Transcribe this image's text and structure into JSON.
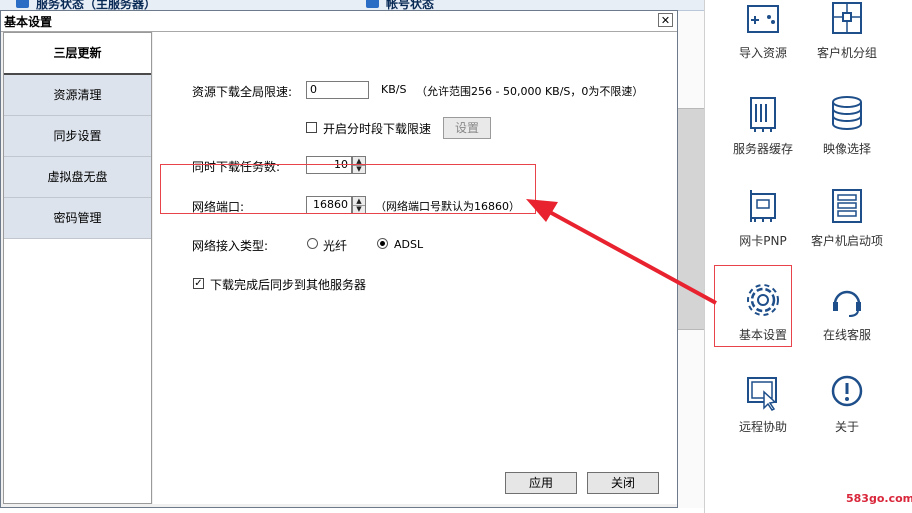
{
  "background_app": {
    "top_tab_1": "服务状态（主服务器）",
    "top_tab_2": "帐号状态"
  },
  "dialog": {
    "title": "基本设置",
    "close_glyph": "✕",
    "sidebar_items": [
      "三层更新",
      "资源清理",
      "同步设置",
      "虚拟盘无盘",
      "密码管理"
    ],
    "active_item": "三层更新",
    "download_limit": {
      "label": "资源下载全局限速:",
      "value": "0",
      "unit": "KB/S",
      "hint": "（允许范围256 - 50,000 KB/S，0为不限速）"
    },
    "timed_limit": {
      "label": "开启分时段下载限速",
      "checked": false,
      "button": "设置"
    },
    "concurrent_tasks": {
      "label": "同时下载任务数:",
      "value": "10"
    },
    "network_port": {
      "label": "网络端口:",
      "value": "16860",
      "hint": "（网络端口号默认为16860）"
    },
    "access_type": {
      "label": "网络接入类型:",
      "options": [
        "光纤",
        "ADSL"
      ],
      "selected": "ADSL"
    },
    "sync_after": {
      "label": "下载完成后同步到其他服务器",
      "checked": true
    },
    "apply_button": "应用",
    "close_button": "关闭"
  },
  "right_panel": {
    "tiles": [
      {
        "label": "导入资源",
        "icon": "gamepad-icon"
      },
      {
        "label": "客户机分组",
        "icon": "group-icon"
      },
      {
        "label": "服务器缓存",
        "icon": "memory-chip-icon"
      },
      {
        "label": "映像选择",
        "icon": "disk-stack-icon"
      },
      {
        "label": "网卡PNP",
        "icon": "network-card-icon"
      },
      {
        "label": "客户机启动项",
        "icon": "list-icon"
      },
      {
        "label": "基本设置",
        "icon": "gear-icon"
      },
      {
        "label": "在线客服",
        "icon": "headset-icon"
      },
      {
        "label": "远程协助",
        "icon": "remote-screen-icon"
      },
      {
        "label": "关于",
        "icon": "info-icon"
      }
    ],
    "highlighted": "基本设置"
  },
  "watermark": "583go.com",
  "colors": {
    "highlight": "#e8424b",
    "arrow": "#e8232f",
    "icon_blue": "#1e4f8a",
    "nav_bg": "#dde3ec"
  }
}
